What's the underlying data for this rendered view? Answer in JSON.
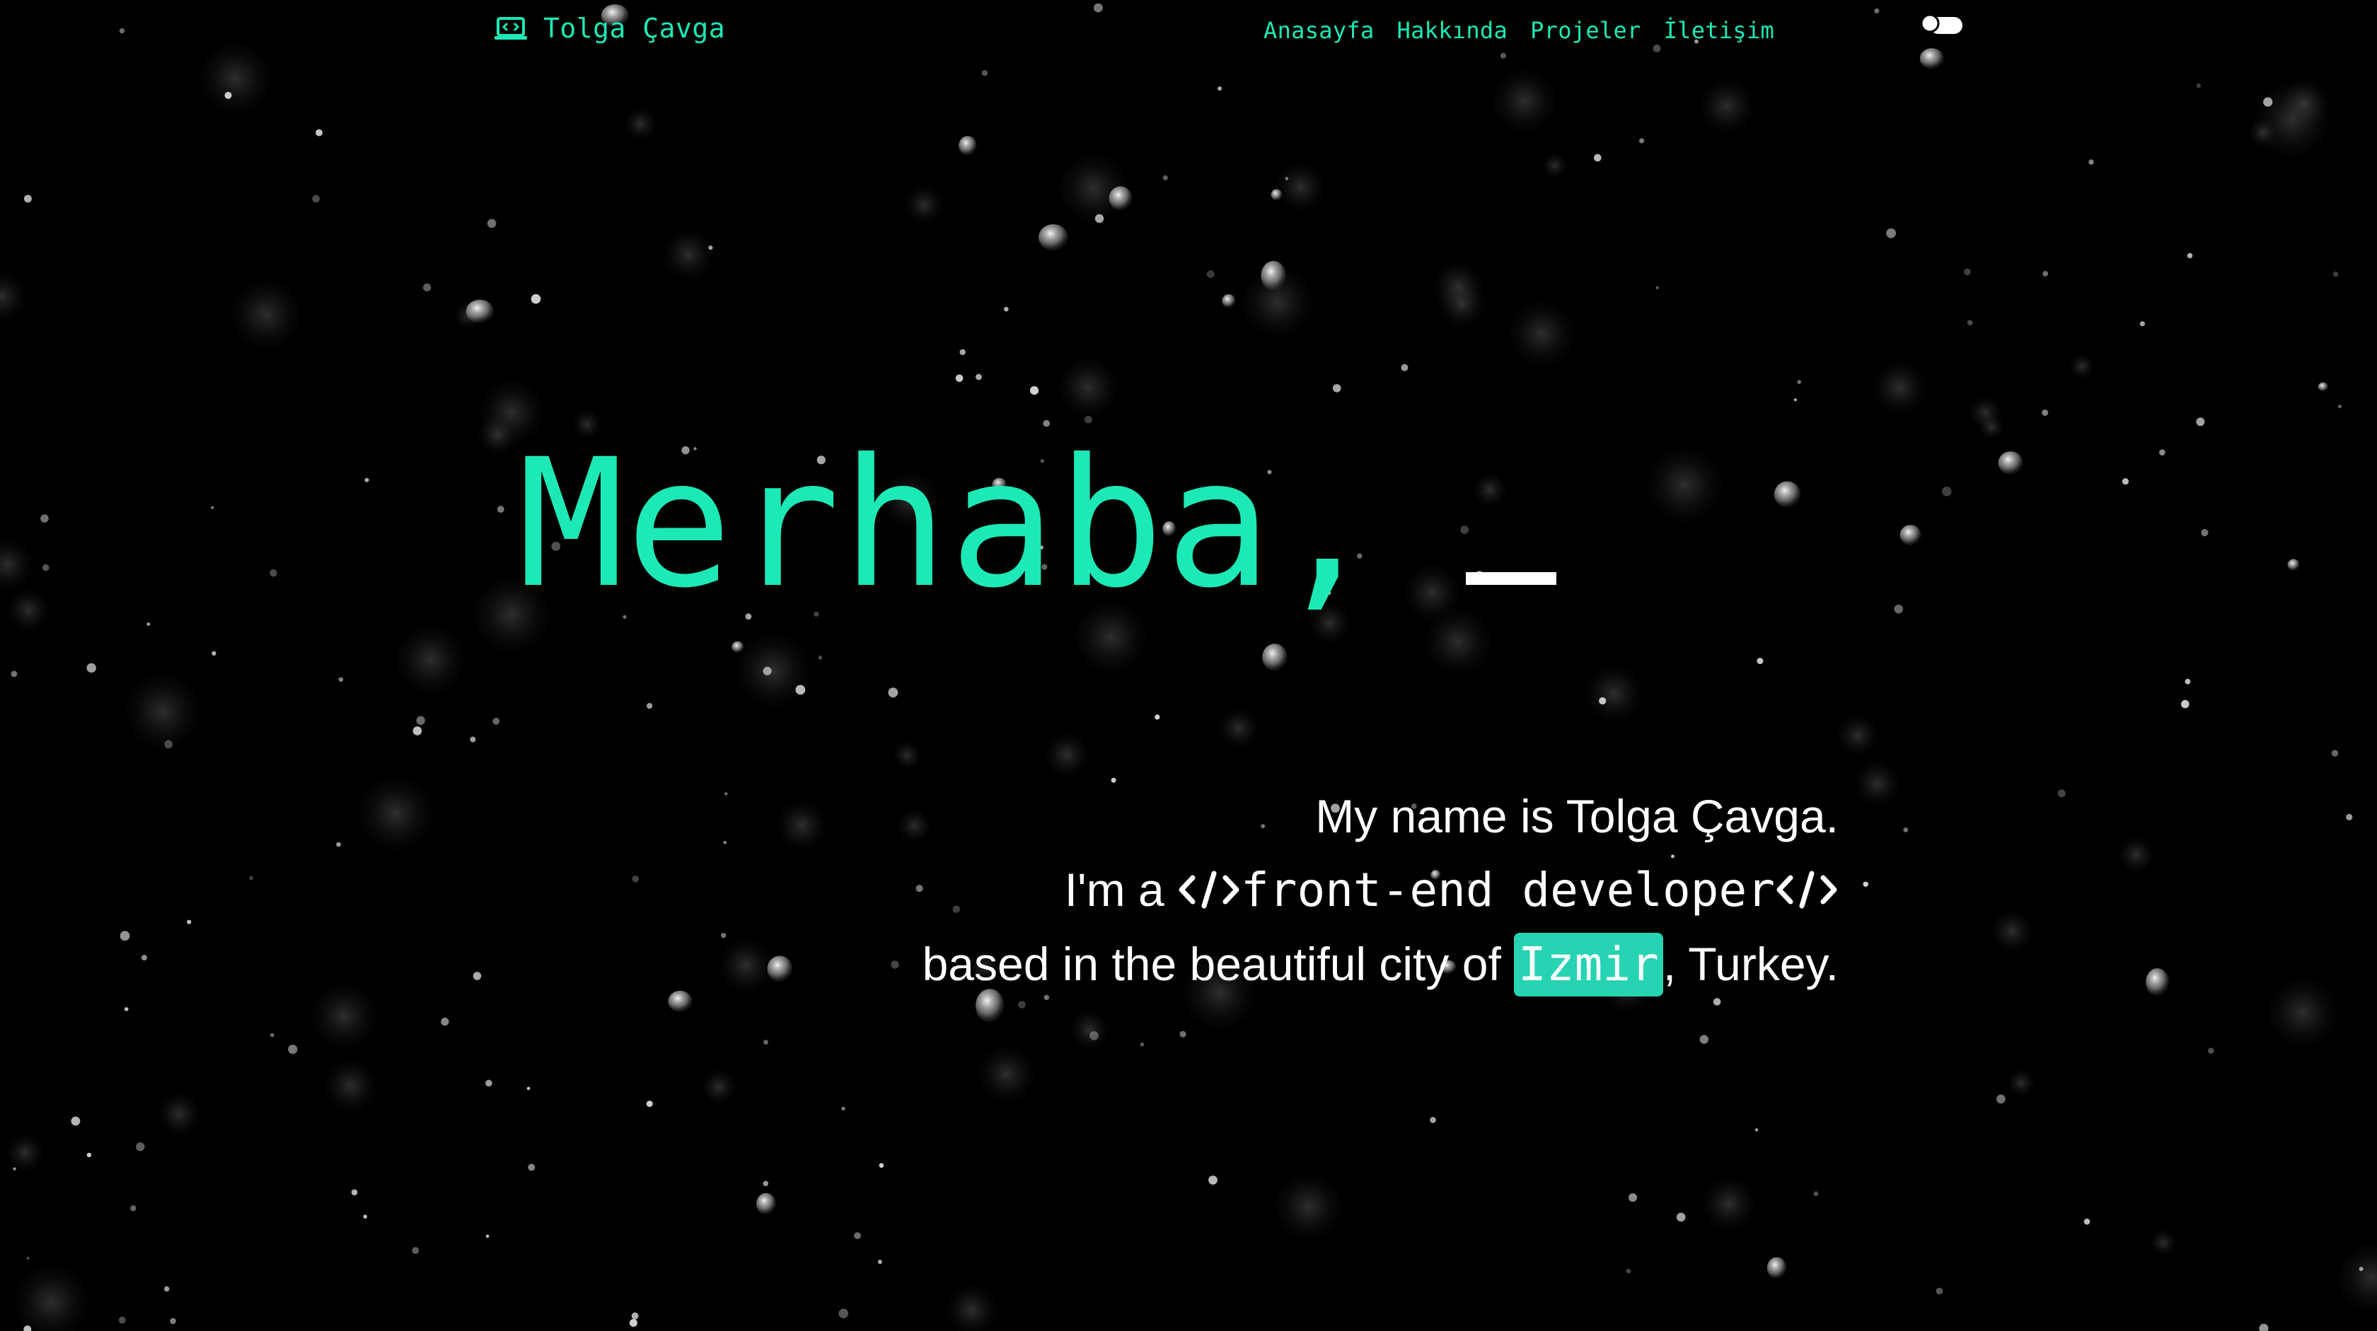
{
  "header": {
    "brand_name": "Tolga Çavga",
    "brand_icon": "laptop-code-icon",
    "nav": [
      {
        "label": "Anasayfa"
      },
      {
        "label": "Hakkında"
      },
      {
        "label": "Projeler"
      },
      {
        "label": "İletişim"
      }
    ],
    "theme_toggle_icon": "toggle-icon"
  },
  "hero": {
    "greeting": "Merhaba,"
  },
  "intro": {
    "line1": "My name is Tolga Çavga.",
    "line2_prefix": "I'm a",
    "role": "front-end developer",
    "line3_prefix": "based in the beautiful city of",
    "city": "Izmir",
    "line3_suffix": ", Turkey."
  },
  "colors": {
    "accent": "#1de9b6",
    "chip": "#26d3b2",
    "background": "#000000",
    "text": "#ffffff"
  }
}
